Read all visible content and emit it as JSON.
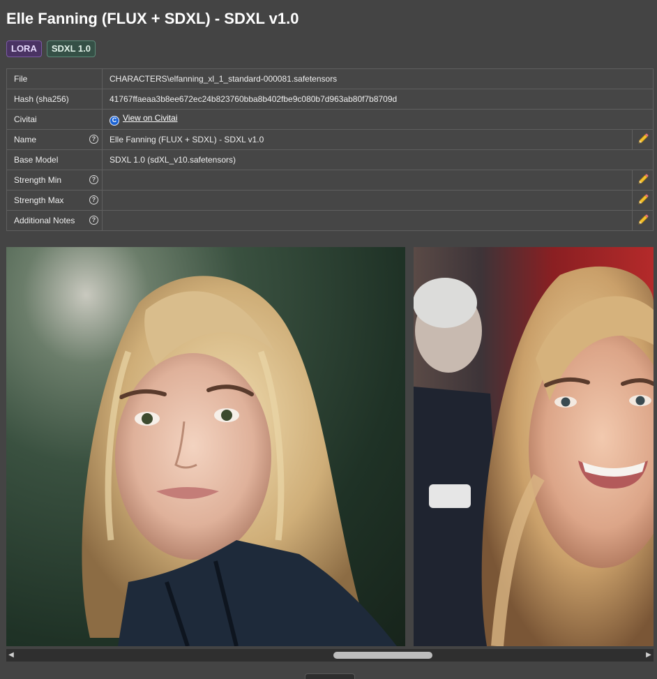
{
  "title": "Elle Fanning (FLUX + SDXL) - SDXL v1.0",
  "tags": {
    "type": "LORA",
    "base": "SDXL 1.0"
  },
  "info": {
    "file_label": "File",
    "file_value": "CHARACTERS\\elfanning_xl_1_standard-000081.safetensors",
    "hash_label": "Hash (sha256)",
    "hash_value": "41767ffaeaa3b8ee672ec24b823760bba8b402fbe9c080b7d963ab80f7b8709d",
    "civitai_label": "Civitai",
    "civitai_link": "View on Civitai",
    "name_label": "Name",
    "name_value": "Elle Fanning (FLUX + SDXL) - SDXL v1.0",
    "base_model_label": "Base Model",
    "base_model_value": "SDXL 1.0 (sdXL_v10.safetensors)",
    "strength_min_label": "Strength Min",
    "strength_min_value": "",
    "strength_max_label": "Strength Max",
    "strength_max_value": "",
    "notes_label": "Additional Notes",
    "notes_value": ""
  },
  "icons": {
    "help": "?",
    "civitai": "C",
    "edit": "pencil-icon",
    "scroll_left": "◀",
    "scroll_right": "▶"
  },
  "colors": {
    "background": "#444444",
    "lora_tag": "#4a3363",
    "sdxl_tag": "#355046",
    "civitai_blue": "#1b63d4",
    "scroll_thumb": "#bdbdbd"
  },
  "scroll_position": 0.6
}
